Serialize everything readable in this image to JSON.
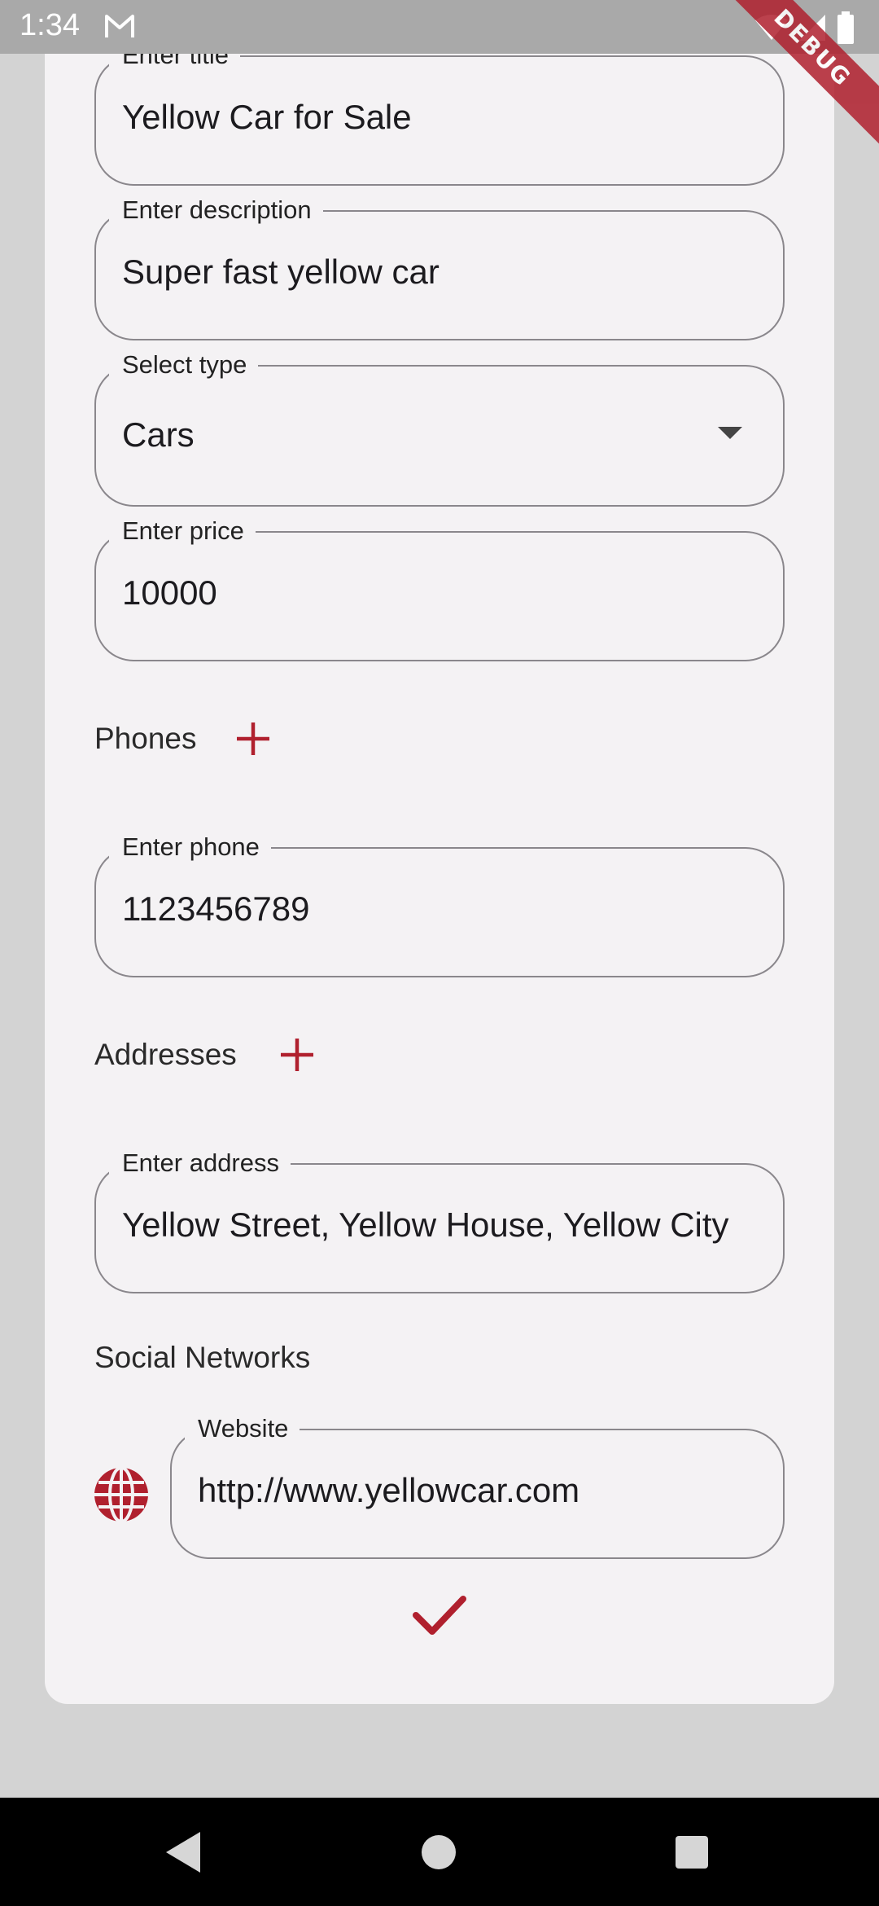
{
  "status_bar": {
    "time": "1:34",
    "icons": [
      "gmail-icon",
      "wifi-icon",
      "signal-icon",
      "battery-icon"
    ]
  },
  "debug_banner": "DEBUG",
  "form": {
    "title": {
      "label": "Enter title",
      "value": "Yellow Car for Sale"
    },
    "description": {
      "label": "Enter description",
      "value": "Super fast yellow car"
    },
    "type": {
      "label": "Select type",
      "value": "Cars"
    },
    "price": {
      "label": "Enter price",
      "value": "10000"
    },
    "phones": {
      "section_label": "Phones",
      "phone": {
        "label": "Enter phone",
        "value": "1123456789"
      }
    },
    "addresses": {
      "section_label": "Addresses",
      "address": {
        "label": "Enter address",
        "value": "Yellow Street, Yellow House, Yellow City"
      }
    },
    "social": {
      "section_label": "Social Networks",
      "website": {
        "label": "Website",
        "value": "http://www.yellowcar.com"
      }
    }
  },
  "colors": {
    "accent": "#b0202e",
    "card_background": "#f4f2f4",
    "page_background": "#d3d3d3",
    "border": "#8a878c"
  }
}
